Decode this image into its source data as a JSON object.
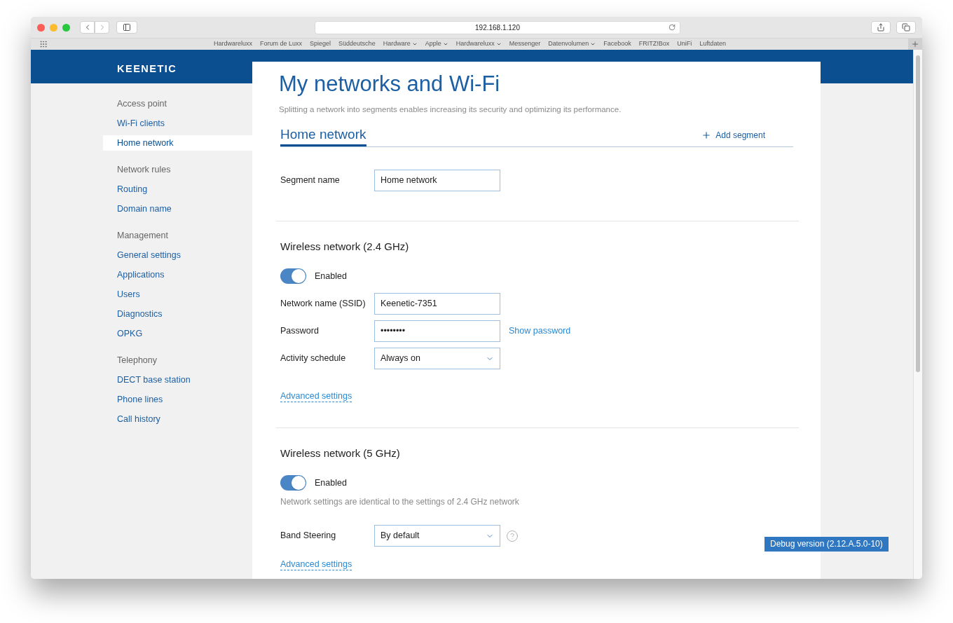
{
  "browser": {
    "address": "192.168.1.120",
    "bookmarks": [
      {
        "label": "Hardwareluxx",
        "menu": false
      },
      {
        "label": "Forum de Luxx",
        "menu": false
      },
      {
        "label": "Spiegel",
        "menu": false
      },
      {
        "label": "Süddeutsche",
        "menu": false
      },
      {
        "label": "Hardware",
        "menu": true
      },
      {
        "label": "Apple",
        "menu": true
      },
      {
        "label": "Hardwareluxx",
        "menu": true
      },
      {
        "label": "Messenger",
        "menu": false
      },
      {
        "label": "Datenvolumen",
        "menu": true
      },
      {
        "label": "Facebook",
        "menu": false
      },
      {
        "label": "FRITZ!Box",
        "menu": false
      },
      {
        "label": "UniFi",
        "menu": false
      },
      {
        "label": "Luftdaten",
        "menu": false
      }
    ]
  },
  "logo": "KEENETIC",
  "sidebar": [
    {
      "heading": "Access point",
      "items": [
        {
          "label": "Wi-Fi clients",
          "selected": false
        },
        {
          "label": "Home network",
          "selected": true
        }
      ]
    },
    {
      "heading": "Network rules",
      "items": [
        {
          "label": "Routing",
          "selected": false
        },
        {
          "label": "Domain name",
          "selected": false
        }
      ]
    },
    {
      "heading": "Management",
      "items": [
        {
          "label": "General settings",
          "selected": false
        },
        {
          "label": "Applications",
          "selected": false
        },
        {
          "label": "Users",
          "selected": false
        },
        {
          "label": "Diagnostics",
          "selected": false
        },
        {
          "label": "OPKG",
          "selected": false
        }
      ]
    },
    {
      "heading": "Telephony",
      "items": [
        {
          "label": "DECT base station",
          "selected": false
        },
        {
          "label": "Phone lines",
          "selected": false
        },
        {
          "label": "Call history",
          "selected": false
        }
      ]
    }
  ],
  "page": {
    "title": "My networks and Wi-Fi",
    "subtitle": "Splitting a network into segments enables increasing its security and optimizing its performance.",
    "segment_tabs": [
      {
        "label": "Home network",
        "selected": true
      }
    ],
    "add_segment": "Add segment",
    "segment_name": {
      "label": "Segment name",
      "value": "Home network"
    }
  },
  "sections": [
    {
      "title": "Wireless network (2.4 GHz)",
      "toggle": {
        "label": "Enabled",
        "on": true
      },
      "fields": [
        {
          "kind": "text",
          "label": "Network name (SSID)",
          "value": "Keenetic-7351"
        },
        {
          "kind": "password",
          "label": "Password",
          "value": "••••••••",
          "action": "Show password"
        },
        {
          "kind": "select",
          "label": "Activity schedule",
          "value": "Always on"
        }
      ],
      "advanced": "Advanced settings"
    },
    {
      "title": "Wireless network (5 GHz)",
      "toggle": {
        "label": "Enabled",
        "on": true
      },
      "note": "Network settings are identical to the settings of 2.4 GHz network",
      "fields": [
        {
          "kind": "select",
          "label": "Band Steering",
          "value": "By default",
          "help": true
        }
      ],
      "advanced": "Advanced settings"
    }
  ],
  "debug": "Debug version (2.12.A.5.0-10)"
}
